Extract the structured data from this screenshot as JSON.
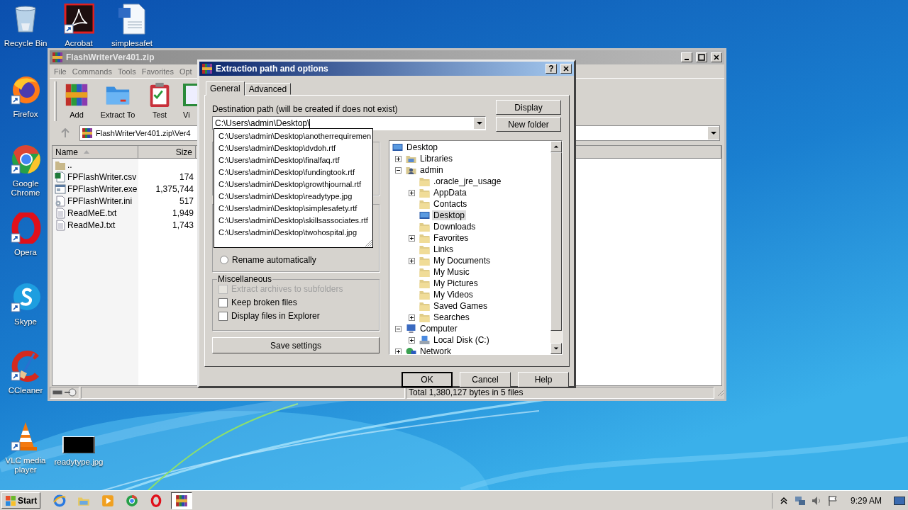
{
  "desktop_icons": [
    {
      "label": "Recycle Bin",
      "kind": "trash",
      "shortcut": false
    },
    {
      "label": "Acrobat",
      "kind": "acrobat",
      "shortcut": true
    },
    {
      "label": "simplesafet",
      "kind": "word",
      "shortcut": false
    },
    {
      "label": "Firefox",
      "kind": "firefox",
      "shortcut": true
    },
    {
      "label": "Google Chrome",
      "kind": "chrome",
      "shortcut": true
    },
    {
      "label": "Opera",
      "kind": "opera",
      "shortcut": true
    },
    {
      "label": "Skype",
      "kind": "skype",
      "shortcut": true
    },
    {
      "label": "CCleaner",
      "kind": "ccleaner",
      "shortcut": true
    },
    {
      "label": "VLC media player",
      "kind": "vlc",
      "shortcut": true
    },
    {
      "label": "readytype.jpg",
      "shortcut": false
    }
  ],
  "archive_window": {
    "title": "FlashWriterVer401.zip",
    "active": false,
    "menu": [
      "File",
      "Commands",
      "Tools",
      "Favorites",
      "Opt"
    ],
    "toolbar": [
      {
        "label": "Add",
        "kind": "add"
      },
      {
        "label": "Extract To",
        "kind": "extract"
      },
      {
        "label": "Test",
        "kind": "test"
      },
      {
        "label": "Vi",
        "kind": "view"
      }
    ],
    "address": "FlashWriterVer401.zip\\Ver4",
    "columns": [
      "Name",
      "Size"
    ],
    "files": [
      {
        "name": "..",
        "kind": "folder"
      },
      {
        "name": "FPFlashWriter.csv",
        "size": "174",
        "kind": "csv"
      },
      {
        "name": "FPFlashWriter.exe",
        "size": "1,375,744",
        "kind": "exe"
      },
      {
        "name": "FPFlashWriter.ini",
        "size": "517",
        "kind": "ini"
      },
      {
        "name": "ReadMeE.txt",
        "size": "1,949",
        "kind": "txt"
      },
      {
        "name": "ReadMeJ.txt",
        "size": "1,743",
        "kind": "txt"
      }
    ],
    "status": "Total 1,380,127 bytes in 5 files"
  },
  "dialog": {
    "title": "Extraction path and options",
    "active": true,
    "help_button": "?",
    "tabs": [
      {
        "label": "General",
        "selected": true
      },
      {
        "label": "Advanced",
        "selected": false
      }
    ],
    "destination_label": "Destination path (will be created if does not exist)",
    "destination_path": "C:\\Users\\admin\\Desktop\\",
    "suggestions": [
      "C:\\Users\\admin\\Desktop\\anotherrequiremen",
      "C:\\Users\\admin\\Desktop\\dvdoh.rtf",
      "C:\\Users\\admin\\Desktop\\finalfaq.rtf",
      "C:\\Users\\admin\\Desktop\\fundingtook.rtf",
      "C:\\Users\\admin\\Desktop\\growthjournal.rtf",
      "C:\\Users\\admin\\Desktop\\readytype.jpg",
      "C:\\Users\\admin\\Desktop\\simplesafety.rtf",
      "C:\\Users\\admin\\Desktop\\skillsassociates.rtf",
      "C:\\Users\\admin\\Desktop\\twohospital.jpg"
    ],
    "side_buttons": [
      "Display",
      "New folder"
    ],
    "rename": {
      "label": "Rename automatically",
      "selected": false
    },
    "misc": {
      "title": "Miscellaneous",
      "options": [
        {
          "label": "Extract archives to subfolders",
          "checked": false,
          "disabled": true
        },
        {
          "label": "Keep broken files",
          "checked": false,
          "disabled": false
        },
        {
          "label": "Display files in Explorer",
          "checked": false,
          "disabled": false
        }
      ]
    },
    "save_button": "Save settings",
    "tree": [
      {
        "label": "Desktop",
        "kind": "desktop",
        "selected": false,
        "children": [
          {
            "label": "Libraries",
            "kind": "library",
            "selected": false,
            "expanded": false
          },
          {
            "label": "admin",
            "kind": "user",
            "selected": false,
            "expanded": true,
            "children": [
              {
                "label": ".oracle_jre_usage",
                "kind": "folder",
                "selected": false
              },
              {
                "label": "AppData",
                "kind": "folder",
                "selected": false,
                "expanded": false
              },
              {
                "label": "Contacts",
                "kind": "folder",
                "selected": false
              },
              {
                "label": "Desktop",
                "kind": "desktop",
                "selected": true
              },
              {
                "label": "Downloads",
                "kind": "folder",
                "selected": false
              },
              {
                "label": "Favorites",
                "kind": "folder",
                "selected": false,
                "expanded": false
              },
              {
                "label": "Links",
                "kind": "folder",
                "selected": false
              },
              {
                "label": "My Documents",
                "kind": "folder",
                "selected": false,
                "expanded": false
              },
              {
                "label": "My Music",
                "kind": "folder",
                "selected": false
              },
              {
                "label": "My Pictures",
                "kind": "folder",
                "selected": false
              },
              {
                "label": "My Videos",
                "kind": "folder",
                "selected": false
              },
              {
                "label": "Saved Games",
                "kind": "folder",
                "selected": false
              },
              {
                "label": "Searches",
                "kind": "folder",
                "selected": false,
                "expanded": false
              }
            ]
          },
          {
            "label": "Computer",
            "kind": "computer",
            "selected": false,
            "expanded": true,
            "children": [
              {
                "label": "Local Disk (C:)",
                "kind": "disk",
                "selected": false,
                "expanded": false
              }
            ]
          },
          {
            "label": "Network",
            "kind": "network",
            "selected": false,
            "expanded": false
          }
        ]
      }
    ],
    "footer_buttons": [
      {
        "label": "OK",
        "default": true
      },
      {
        "label": "Cancel",
        "default": false
      },
      {
        "label": "Help",
        "default": false
      }
    ]
  },
  "taskbar": {
    "start": "Start",
    "apps": [
      {
        "kind": "ie",
        "active": false
      },
      {
        "kind": "explorer",
        "active": false
      },
      {
        "kind": "media",
        "active": false
      },
      {
        "kind": "chrome",
        "active": false
      },
      {
        "kind": "opera",
        "active": false
      },
      {
        "kind": "winrar",
        "active": true
      }
    ],
    "clock": "9:29 AM"
  }
}
